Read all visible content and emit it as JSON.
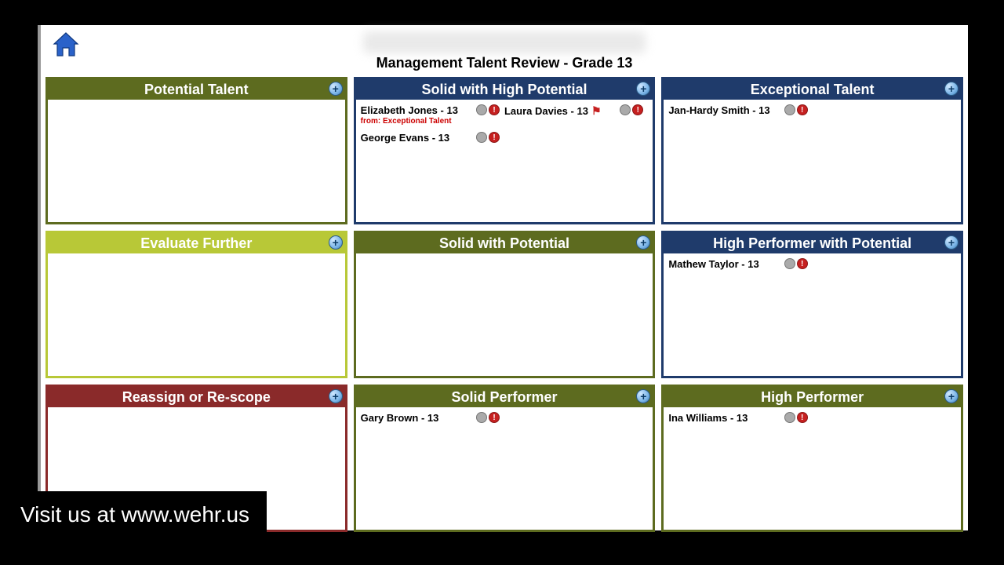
{
  "page_title": "Management Talent Review - Grade 13",
  "caption": "Visit us at www.wehr.us",
  "grid": [
    {
      "title": "Potential Talent",
      "theme": "olive",
      "people": []
    },
    {
      "title": "Solid with High Potential",
      "theme": "navy",
      "people": [
        {
          "name": "Elizabeth Jones - 13",
          "note": "from: Exceptional Talent",
          "flag": ""
        },
        {
          "name": "Laura Davies - 13",
          "note": "",
          "flag": "⚑"
        },
        {
          "name": "George Evans - 13",
          "note": "",
          "flag": ""
        }
      ]
    },
    {
      "title": "Exceptional Talent",
      "theme": "navy",
      "people": [
        {
          "name": "Jan-Hardy Smith - 13",
          "note": "",
          "flag": ""
        }
      ]
    },
    {
      "title": "Evaluate Further",
      "theme": "lime",
      "people": []
    },
    {
      "title": "Solid with Potential",
      "theme": "olive",
      "people": []
    },
    {
      "title": "High Performer with Potential",
      "theme": "navy",
      "people": [
        {
          "name": "Mathew Taylor - 13",
          "note": "",
          "flag": ""
        }
      ]
    },
    {
      "title": "Reassign or Re-scope",
      "theme": "maroon",
      "people": []
    },
    {
      "title": "Solid Performer",
      "theme": "olive",
      "people": [
        {
          "name": "Gary Brown - 13",
          "note": "",
          "flag": ""
        }
      ]
    },
    {
      "title": "High Performer",
      "theme": "olive",
      "people": [
        {
          "name": "Ina Williams - 13",
          "note": "",
          "flag": ""
        }
      ]
    }
  ],
  "icons": {
    "add": "+"
  }
}
